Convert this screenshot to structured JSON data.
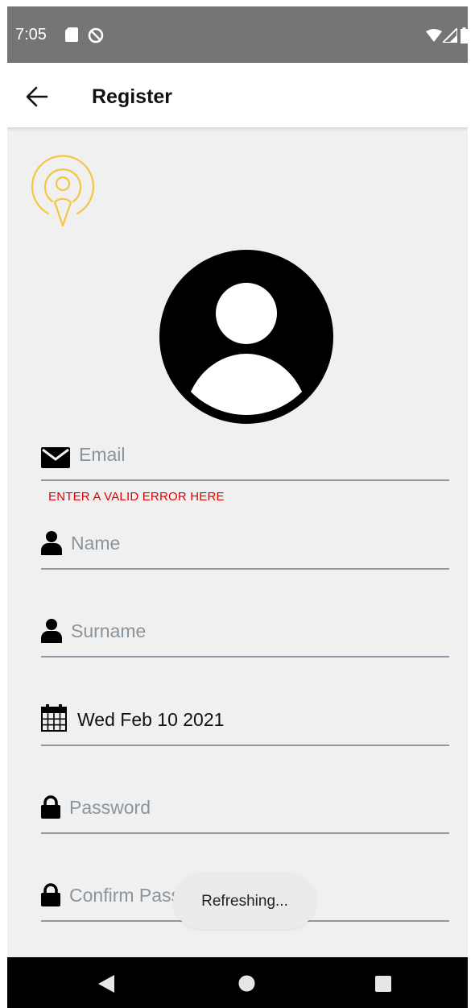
{
  "status_bar": {
    "time": "7:05",
    "icons": [
      "sd-card-icon",
      "dnd-icon",
      "wifi-icon",
      "signal-icon",
      "battery-icon"
    ]
  },
  "app_bar": {
    "title": "Register",
    "back_icon": "arrow-left-icon"
  },
  "logo": {
    "icon": "podcast-icon",
    "color": "#f5c542"
  },
  "avatar": {
    "icon": "user-avatar-icon"
  },
  "form": {
    "email": {
      "placeholder": "Email",
      "icon": "envelope-icon",
      "error": "ENTER A VALID ERROR HERE"
    },
    "name": {
      "placeholder": "Name",
      "icon": "user-icon"
    },
    "surname": {
      "placeholder": "Surname",
      "icon": "user-icon"
    },
    "birth_date": {
      "value": "Wed Feb 10 2021",
      "icon": "calendar-icon"
    },
    "password": {
      "placeholder": "Password",
      "icon": "lock-icon"
    },
    "confirm_password": {
      "placeholder": "Confirm Password",
      "icon": "lock-icon"
    }
  },
  "toast": {
    "text": "Refreshing..."
  },
  "nav_bar": {
    "icons": [
      "nav-back-icon",
      "nav-home-icon",
      "nav-recents-icon"
    ]
  },
  "colors": {
    "error": "#e00000",
    "field_line": "#8e99a5",
    "placeholder": "#8a949d",
    "status_bar": "#757575"
  }
}
